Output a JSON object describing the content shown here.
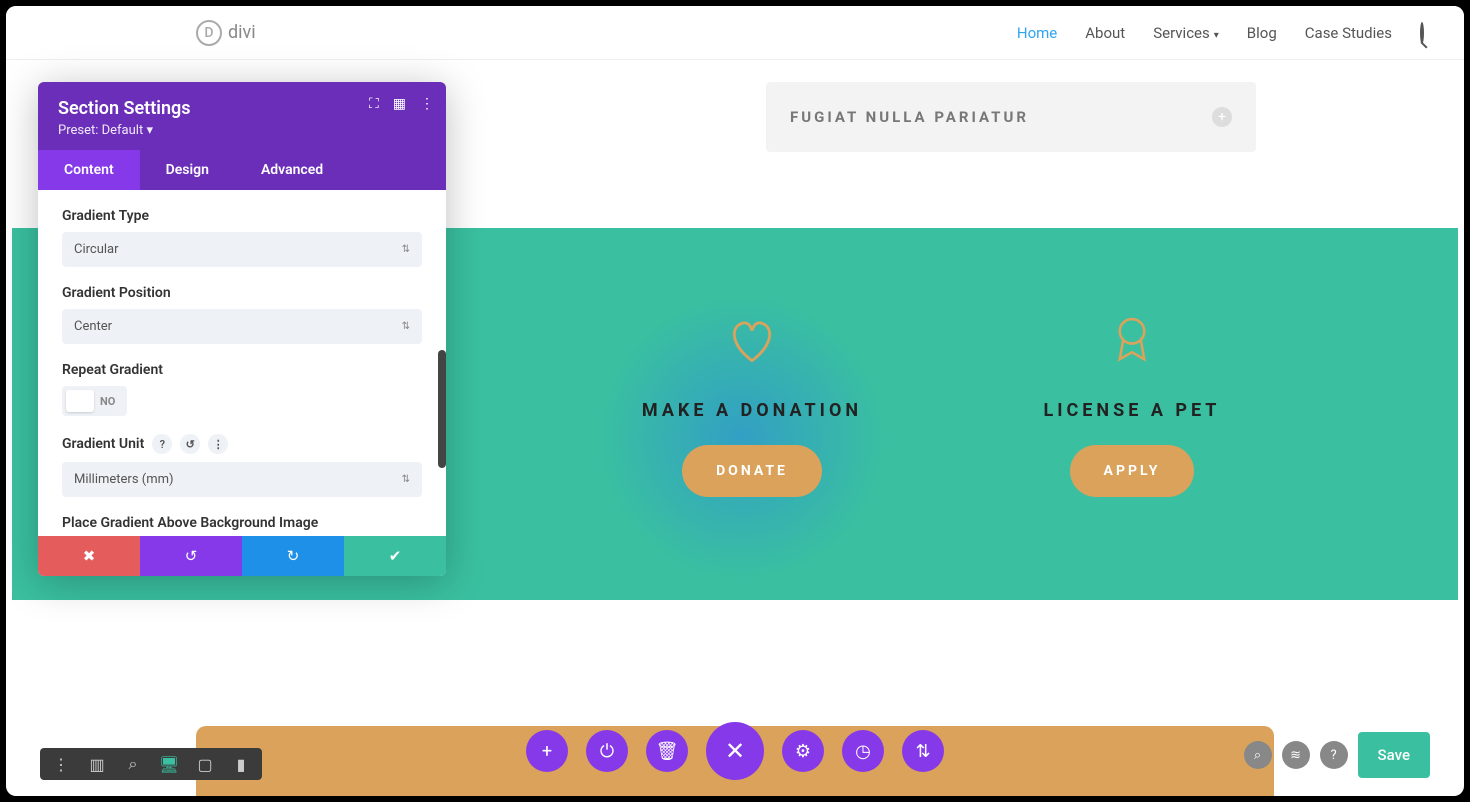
{
  "brand": "divi",
  "nav": {
    "items": [
      "Home",
      "About",
      "Services",
      "Blog",
      "Case Studies"
    ],
    "active_index": 0
  },
  "accordion": {
    "title": "FUGIAT NULLA PARIATUR"
  },
  "cta": {
    "left": {
      "heading": "MAKE A DONATION",
      "button": "DONATE"
    },
    "right": {
      "heading": "LICENSE A PET",
      "button": "APPLY"
    }
  },
  "panel": {
    "title": "Section Settings",
    "preset": "Preset: Default",
    "tabs": [
      "Content",
      "Design",
      "Advanced"
    ],
    "active_tab": 0,
    "fields": {
      "gradient_type": {
        "label": "Gradient Type",
        "value": "Circular"
      },
      "gradient_position": {
        "label": "Gradient Position",
        "value": "Center"
      },
      "repeat_gradient": {
        "label": "Repeat Gradient",
        "value": "NO"
      },
      "gradient_unit": {
        "label": "Gradient Unit",
        "value": "Millimeters (mm)"
      },
      "place_above": {
        "label": "Place Gradient Above Background Image"
      }
    }
  },
  "save_label": "Save",
  "colors": {
    "accent_purple": "#8639e8",
    "header_purple": "#6b2eb8",
    "teal": "#3ac0a0",
    "orange": "#daa25b",
    "red": "#e55c5c",
    "blue": "#1e90e8"
  }
}
